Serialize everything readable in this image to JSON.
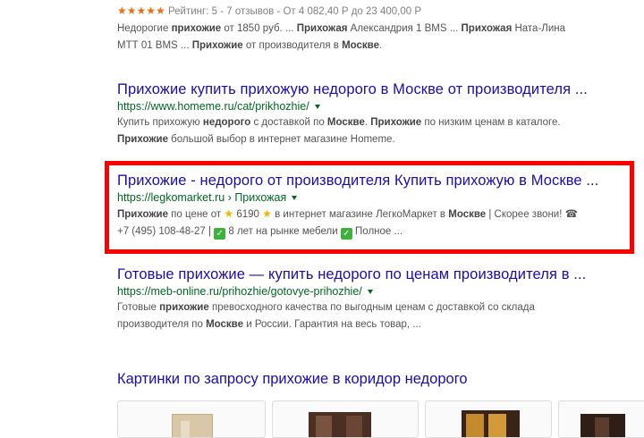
{
  "result0": {
    "stars": "★★★★★",
    "rating_text": "Рейтинг: 5 - 7 отзывов - От 4 082,40 Р до 23 400,00 Р",
    "snippet_line1_parts": [
      "Недорогие ",
      "прихожие",
      " от 1850 руб. ... ",
      "Прихожая",
      " Александрия 1 BMS ... ",
      "Прихожая",
      " Ната-Лина"
    ],
    "snippet_line2_parts": [
      "МТТ 01 BMS ... ",
      "Прихожие",
      " от производителя в ",
      "Москве",
      "."
    ]
  },
  "result1": {
    "title": "Прихожие купить прихожую недорого в Москве от производителя ...",
    "url": "https://www.homeme.ru/cat/prikhozhie/",
    "snippet_line1_parts": [
      "Купить прихожую ",
      "недорого",
      " с доставкой по ",
      "Москве",
      ". ",
      "Прихожие",
      " по низким ценам в каталоге."
    ],
    "snippet_line2_parts": [
      "Прихожие",
      " большой выбор в интернет магазине Homeme."
    ]
  },
  "result2": {
    "title": "Прихожие - недорого от производителя Купить прихожую в Москве ...",
    "url": "https://legkomarket.ru",
    "breadcrumb": "Прихожая",
    "snippet_line1_parts": [
      "Прихожие",
      " по цене от ",
      "6190",
      " в интернет магазине ЛегкоМаркет в ",
      "Москве",
      " | Скорее звони! "
    ],
    "snippet_line2_parts": [
      "+7 (495) 108-48-27 | ",
      "8 лет на рынке мебели ",
      "Полное ..."
    ]
  },
  "result3": {
    "title": "Готовые прихожие — купить недорого по ценам производителя в ...",
    "url": "https://meb-online.ru/prihozhie/gotovye-prihozhie/",
    "snippet_line1_parts": [
      "Готовые ",
      "прихожие",
      " превосходного качества по выгодным ценам с доставкой со склада"
    ],
    "snippet_line2_parts": [
      "производителя по ",
      "Москве",
      " и России. Гарантия на весь товар, ..."
    ]
  },
  "images": {
    "title": "Картинки по запросу прихожие в коридор недорого"
  },
  "colors": {
    "link": "#1a0dab",
    "url": "#006621",
    "snippet": "#545454",
    "highlight_border": "#ff0000",
    "check": "#3bb33b"
  }
}
